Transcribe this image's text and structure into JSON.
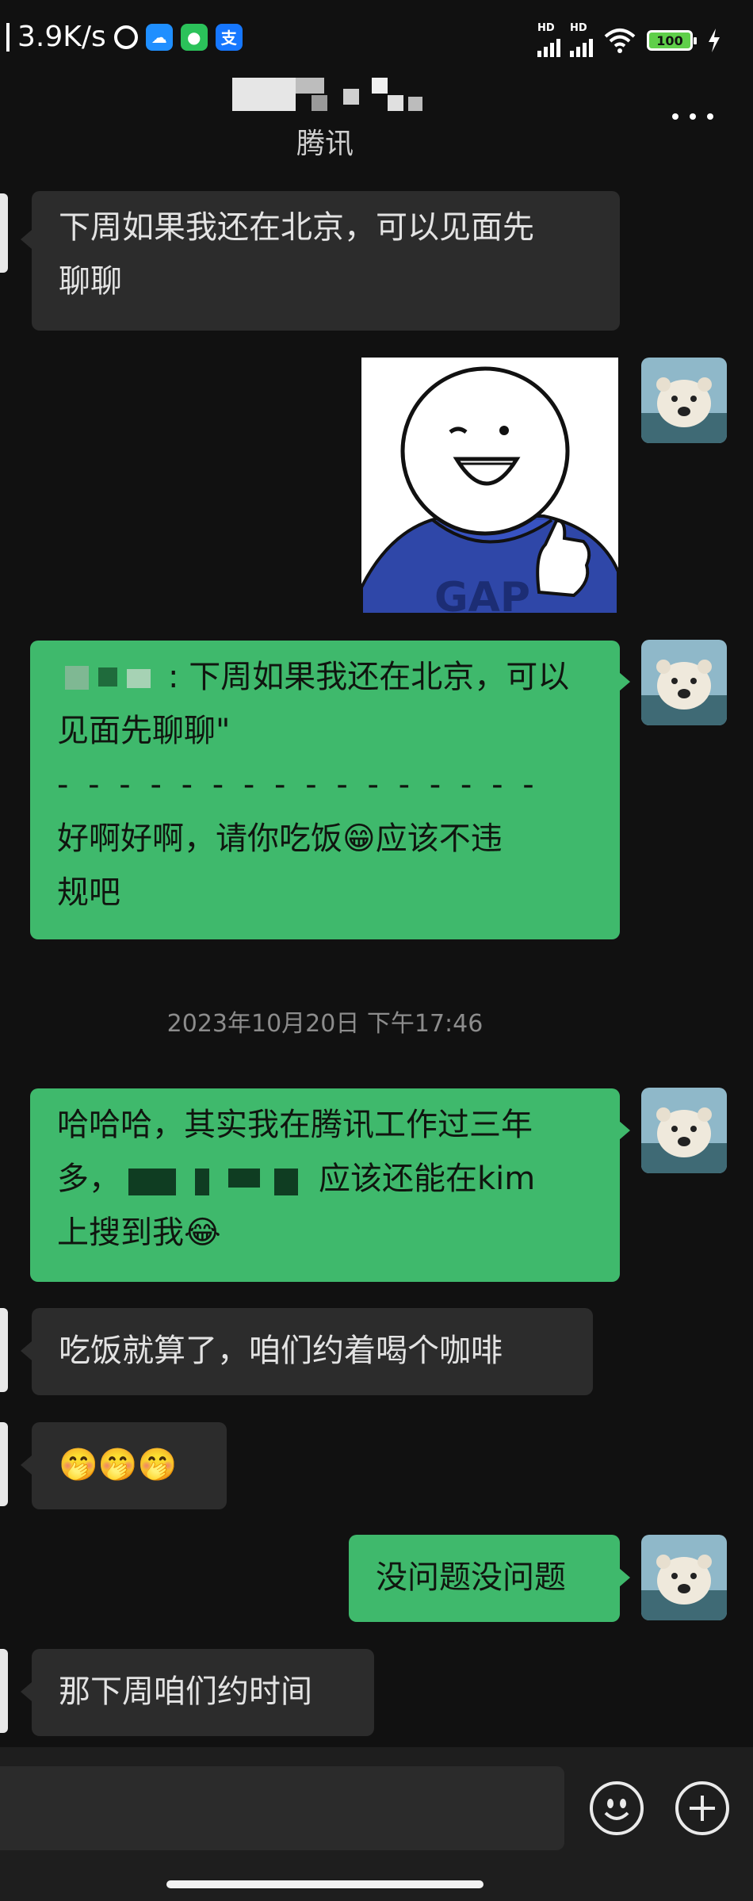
{
  "status_bar": {
    "net_speed": "3.9K/s",
    "battery": "100",
    "hd1": "HD",
    "hd2": "HD"
  },
  "header": {
    "contact_subtitle": "腾讯",
    "more_icon": "more-horizontal-icon"
  },
  "messages": [
    {
      "side": "in",
      "text_lines": [
        "下周如果我还在北京，可以见面先",
        "聊聊"
      ]
    },
    {
      "side": "out",
      "type": "sticker",
      "sticker": "thumbs-up-hoodie-sticker"
    },
    {
      "side": "out",
      "quote_tail": ": 下周如果我还在北京，可以",
      "quote_line2": "见面先聊聊\"",
      "divider": "- - - - - - - - - - - - - - - -",
      "reply_line1": "好啊好啊，请你吃饭",
      "reply_emoji": "😁",
      "reply_line1b": "应该不违",
      "reply_line2": "规吧"
    },
    {
      "type": "timestamp",
      "text": "2023年10月20日 下午17:46"
    },
    {
      "side": "out",
      "line1": "哈哈哈，其实我在腾讯工作过三年",
      "line2_a": "多，",
      "line2_b": "应该还能在kim",
      "line3": "上搜到我",
      "line3_emoji": "😂"
    },
    {
      "side": "in",
      "text": "吃饭就算了，咱们约着喝个咖啡"
    },
    {
      "side": "in",
      "emoji": "🤭🤭🤭"
    },
    {
      "side": "out",
      "text": "没问题没问题"
    },
    {
      "side": "in",
      "text": "那下周咱们约时间"
    }
  ],
  "input_bar": {
    "emoji_icon": "emoji-smile-icon",
    "plus_icon": "plus-icon"
  },
  "colors": {
    "background": "#111111",
    "incoming_bubble": "#2c2c2c",
    "outgoing_bubble": "#3fb96c"
  }
}
